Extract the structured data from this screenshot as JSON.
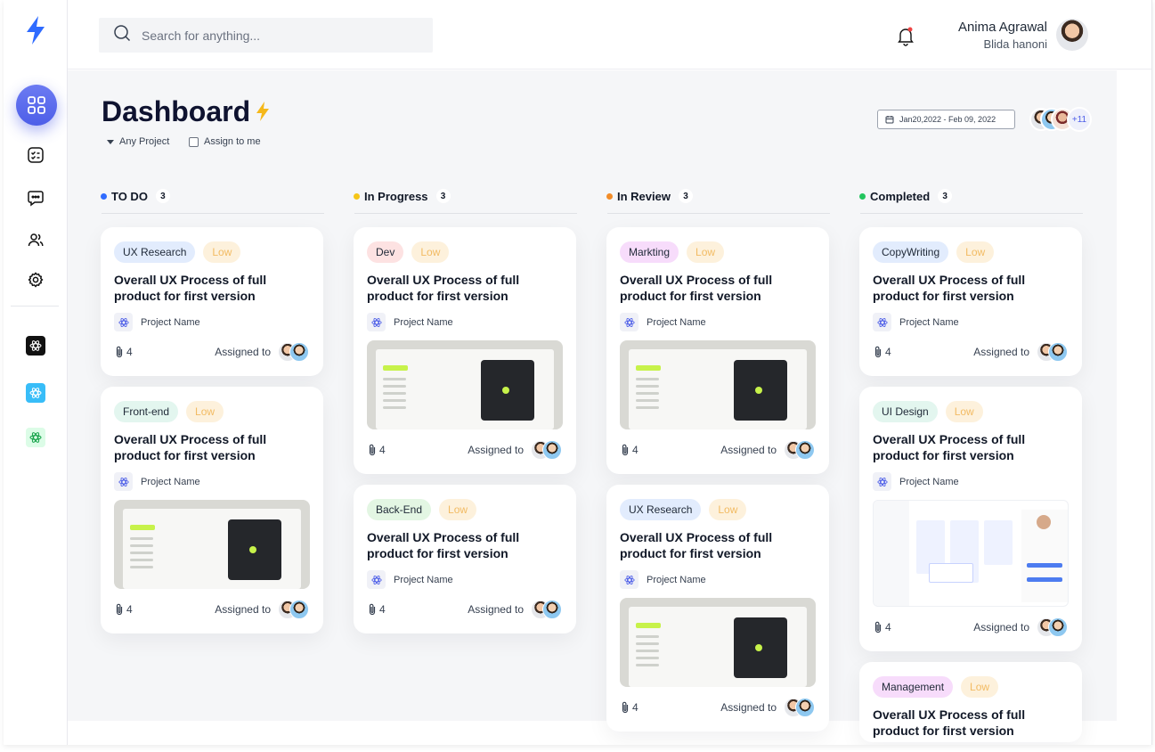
{
  "search": {
    "placeholder": "Search for anything..."
  },
  "user": {
    "name": "Anima Agrawal",
    "subtitle": "Blida hanoni"
  },
  "page": {
    "title": "Dashboard",
    "filters": {
      "project": "Any Project",
      "assign": "Assign to me"
    },
    "date_range": "Jan20,2022 - Feb 09, 2022",
    "team_more": "+11"
  },
  "colors": {
    "accent": "#4d5ee8",
    "todo": "#2f6bff",
    "in_progress": "#f5c518",
    "in_review": "#f28c28",
    "completed": "#22c55e"
  },
  "columns": [
    {
      "name": "TO DO",
      "count": "3",
      "cards": [
        {
          "tag": "UX Research",
          "priority": "Low",
          "title": "Overall UX Process of full product for first version",
          "project": "Project Name",
          "attachments": "4",
          "assigned": "Assigned to"
        },
        {
          "tag": "Front-end",
          "priority": "Low",
          "title": "Overall UX Process of full product for first version",
          "project": "Project Name",
          "attachments": "4",
          "assigned": "Assigned to"
        }
      ]
    },
    {
      "name": "In Progress",
      "count": "3",
      "cards": [
        {
          "tag": "Dev",
          "priority": "Low",
          "title": "Overall UX Process of full product for first version",
          "project": "Project Name",
          "attachments": "4",
          "assigned": "Assigned to"
        },
        {
          "tag": "Back-End",
          "priority": "Low",
          "title": "Overall UX Process of full product for first version",
          "project": "Project Name",
          "attachments": "4",
          "assigned": "Assigned to"
        }
      ]
    },
    {
      "name": "In Review",
      "count": "3",
      "cards": [
        {
          "tag": "Markting",
          "priority": "Low",
          "title": "Overall UX Process of full product for first version",
          "project": "Project Name",
          "attachments": "4",
          "assigned": "Assigned to"
        },
        {
          "tag": "UX Research",
          "priority": "Low",
          "title": "Overall UX Process of full product for first version",
          "project": "Project Name",
          "attachments": "4",
          "assigned": "Assigned to"
        }
      ]
    },
    {
      "name": "Completed",
      "count": "3",
      "cards": [
        {
          "tag": "CopyWriting",
          "priority": "Low",
          "title": "Overall UX Process of full product for first version",
          "project": "Project Name",
          "attachments": "4",
          "assigned": "Assigned to"
        },
        {
          "tag": "UI Design",
          "priority": "Low",
          "title": "Overall UX Process of full product for first version",
          "project": "Project Name",
          "attachments": "4",
          "assigned": "Assigned to"
        },
        {
          "tag": "Management",
          "priority": "Low",
          "title": "Overall UX Process of full product for first version"
        }
      ]
    }
  ]
}
